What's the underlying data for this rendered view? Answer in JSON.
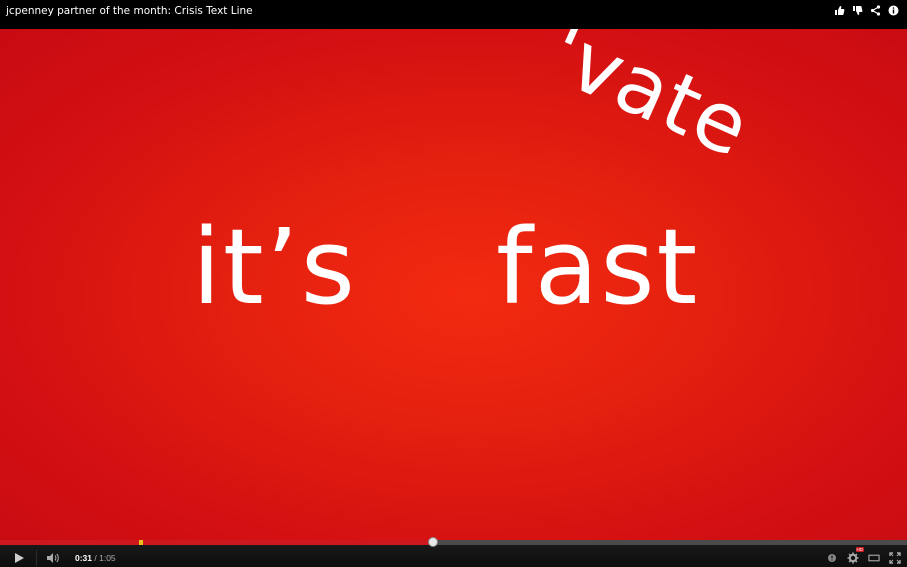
{
  "video": {
    "title": "jcpenney partner of the month: Crisis Text Line",
    "words": {
      "its": "it’s",
      "fast": "fast",
      "private_fragment": "'vate"
    }
  },
  "controls": {
    "current_time": "0:31",
    "separator": " / ",
    "duration": "1:05",
    "progress_fraction": 0.477,
    "hd_badge": "HD"
  },
  "icons": {
    "like": "thumbs-up-icon",
    "dislike": "thumbs-down-icon",
    "share": "share-icon",
    "info": "info-icon",
    "play": "play-icon",
    "volume": "volume-icon",
    "annotations": "annotations-icon",
    "settings": "gear-icon",
    "theater": "theater-mode-icon",
    "fullscreen": "fullscreen-icon"
  },
  "colors": {
    "background_red": "#e4200f",
    "progress_red": "#cc181e",
    "marker_yellow": "#e8c21b"
  }
}
